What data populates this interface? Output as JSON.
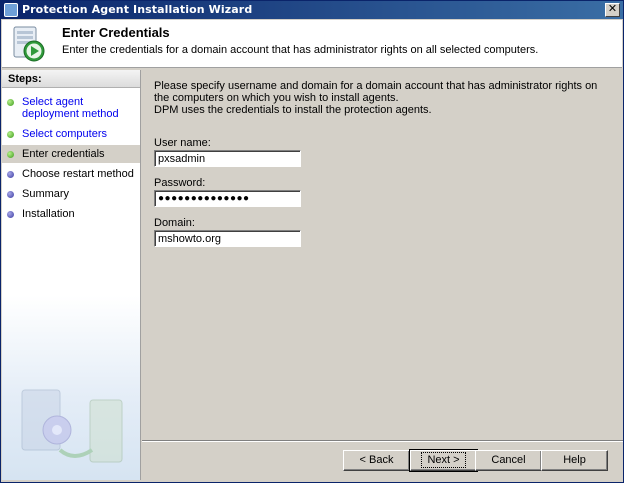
{
  "window": {
    "title": "Protection Agent Installation Wizard",
    "close_label": "✕"
  },
  "header": {
    "title": "Enter Credentials",
    "subtitle": "Enter the credentials for a domain account that has administrator rights on all selected computers."
  },
  "sidebar": {
    "heading": "Steps:",
    "steps": [
      {
        "label": "Select agent deployment method",
        "state": "done"
      },
      {
        "label": "Select computers",
        "state": "done"
      },
      {
        "label": "Enter credentials",
        "state": "current"
      },
      {
        "label": "Choose restart method",
        "state": "todo"
      },
      {
        "label": "Summary",
        "state": "todo"
      },
      {
        "label": "Installation",
        "state": "todo"
      }
    ]
  },
  "content": {
    "intro_line1": "Please specify username and domain for a domain account that has administrator rights on the computers on which you wish to install agents.",
    "intro_line2": "DPM uses the credentials to install the protection agents.",
    "username_label": "User name:",
    "username_value": "pxsadmin",
    "password_label": "Password:",
    "password_value": "●●●●●●●●●●●●●●",
    "domain_label": "Domain:",
    "domain_value": "mshowto.org"
  },
  "buttons": {
    "back": "< Back",
    "next": "Next >",
    "cancel": "Cancel",
    "help": "Help"
  },
  "icons": {
    "header_icon": "server-play-icon",
    "done_dot": "green-dot-icon",
    "todo_dot": "blue-dot-icon"
  }
}
